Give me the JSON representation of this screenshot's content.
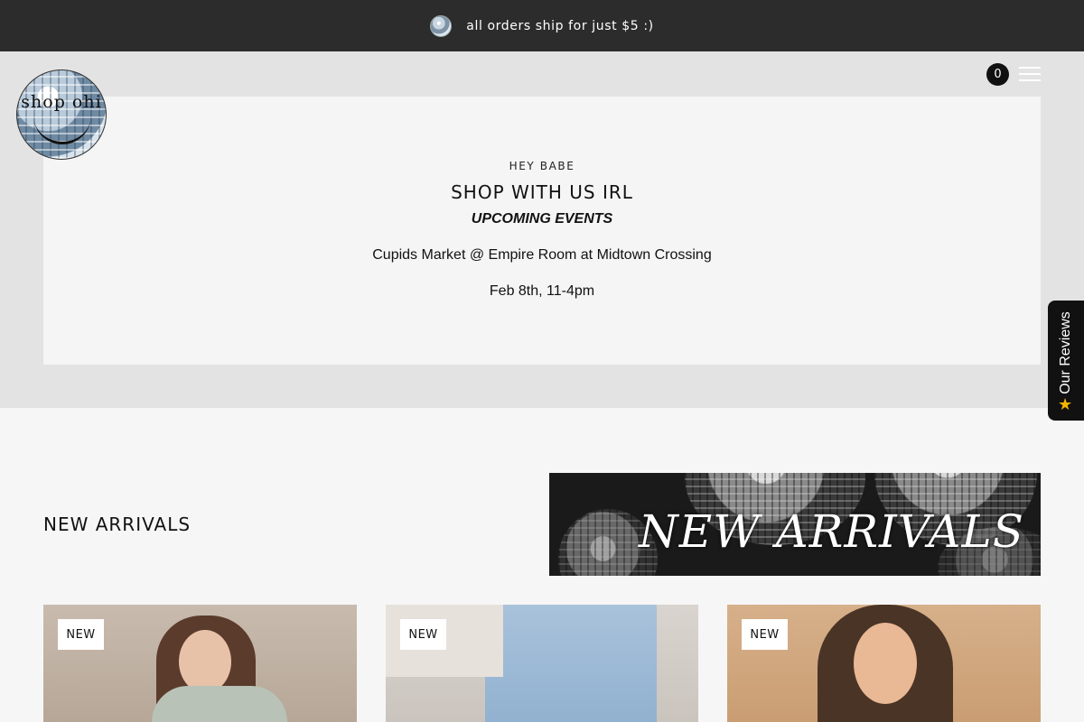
{
  "announcement": {
    "text": "all orders ship for just $5 :)"
  },
  "header": {
    "logo_text": "shop ohi",
    "cart_count": "0"
  },
  "hero": {
    "eyebrow": "HEY BABE",
    "title": "SHOP WITH US IRL",
    "subtitle": "UPCOMING EVENTS",
    "event_line": "Cupids Market @ Empire Room at Midtown Crossing",
    "date_line": "Feb 8th, 11-4pm"
  },
  "reviews_tab": {
    "label": "Our Reviews",
    "icon": "star-icon",
    "star_color": "#f4b400"
  },
  "new_arrivals": {
    "title": "NEW ARRIVALS",
    "banner_text": "NEW ARRIVALS",
    "products": [
      {
        "badge": "NEW"
      },
      {
        "badge": "NEW"
      },
      {
        "badge": "NEW"
      }
    ]
  },
  "colors": {
    "announcement_bg": "#2c2c2c",
    "hero_bg": "#e3e3e3",
    "page_bg": "#f6f6f6"
  }
}
